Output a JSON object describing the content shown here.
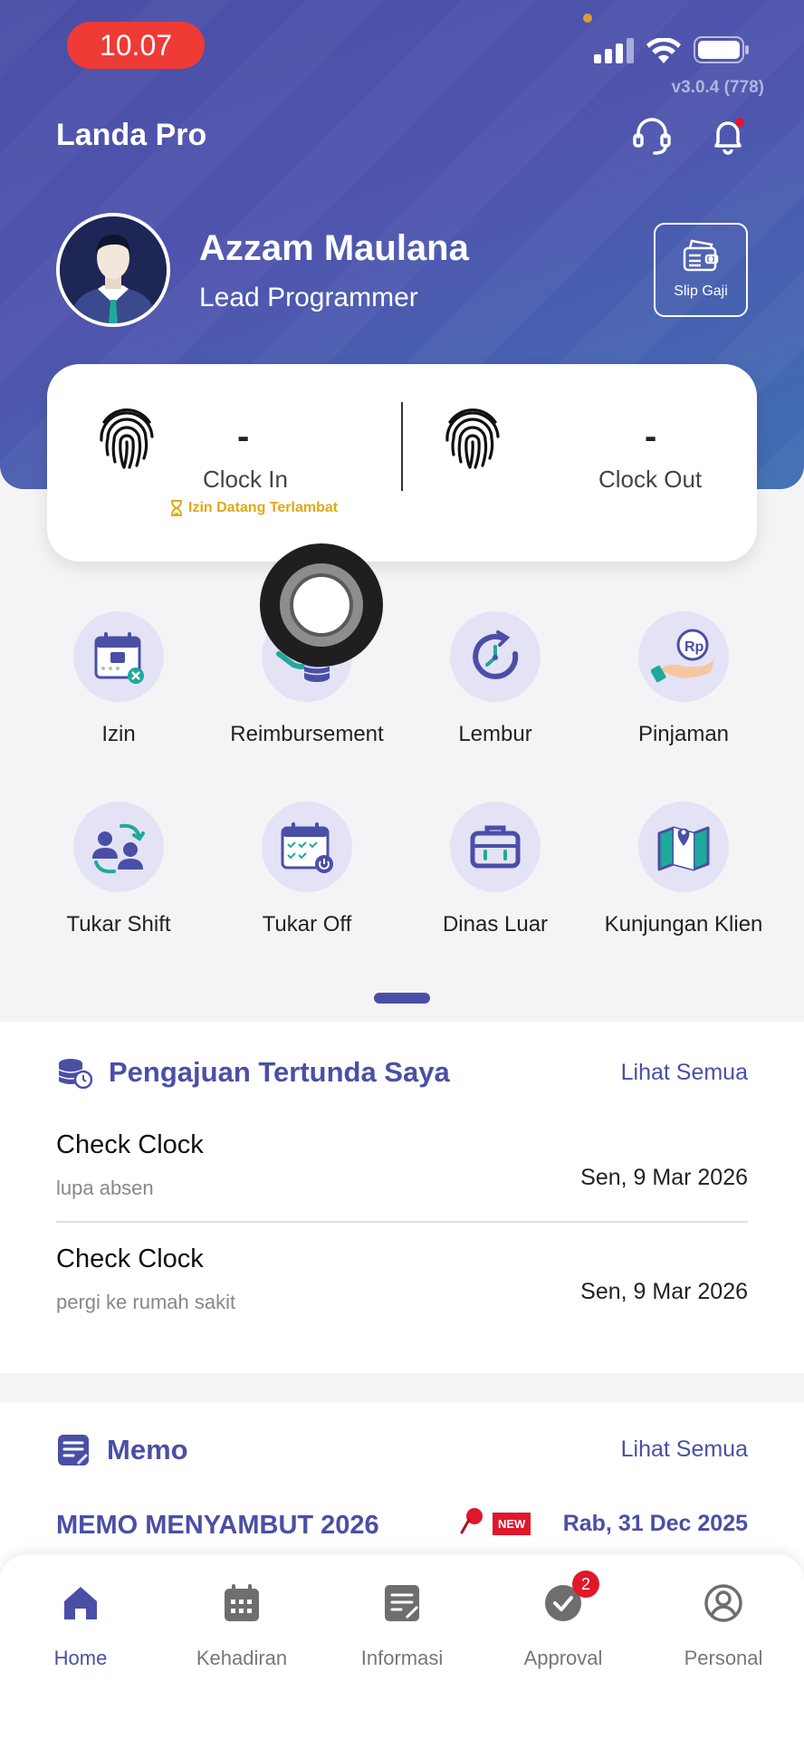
{
  "status_bar": {
    "time": "10.07",
    "version": "v3.0.4 (778)"
  },
  "header": {
    "app_title": "Landa Pro"
  },
  "profile": {
    "name": "Azzam Maulana",
    "role": "Lead Programmer",
    "slip_label": "Slip Gaji"
  },
  "clock": {
    "in": {
      "value": "-",
      "label": "Clock In",
      "note": "Izin Datang Terlambat"
    },
    "out": {
      "value": "-",
      "label": "Clock Out"
    }
  },
  "menu": [
    {
      "label": "Izin",
      "icon": "calendar-cancel-icon"
    },
    {
      "label": "Reimbursement",
      "icon": "money-hand-icon"
    },
    {
      "label": "Lembur",
      "icon": "clock-icon"
    },
    {
      "label": "Pinjaman",
      "icon": "loan-hand-icon"
    },
    {
      "label": "Tukar Shift",
      "icon": "swap-people-icon"
    },
    {
      "label": "Tukar Off",
      "icon": "calendar-power-icon"
    },
    {
      "label": "Dinas Luar",
      "icon": "briefcase-icon"
    },
    {
      "label": "Kunjungan Klien",
      "icon": "map-pin-icon"
    }
  ],
  "pending": {
    "title": "Pengajuan Tertunda Saya",
    "see_all": "Lihat Semua",
    "items": [
      {
        "title": "Check Clock",
        "subtitle": "lupa absen",
        "date": "Sen, 9 Mar 2026"
      },
      {
        "title": "Check Clock",
        "subtitle": "pergi ke rumah sakit",
        "date": "Sen, 9 Mar 2026"
      }
    ]
  },
  "memo": {
    "title": "Memo",
    "see_all": "Lihat Semua",
    "item": {
      "title": "MEMO MENYAMBUT 2026",
      "badge": "NEW",
      "date": "Rab, 31 Dec 2025"
    }
  },
  "nav": [
    {
      "label": "Home",
      "active": true
    },
    {
      "label": "Kehadiran"
    },
    {
      "label": "Informasi"
    },
    {
      "label": "Approval",
      "badge": "2"
    },
    {
      "label": "Personal"
    }
  ],
  "colors": {
    "primary": "#4a4fa6",
    "accent_red": "#e0182b",
    "warning": "#e2a90e",
    "teal": "#1fa99b"
  }
}
